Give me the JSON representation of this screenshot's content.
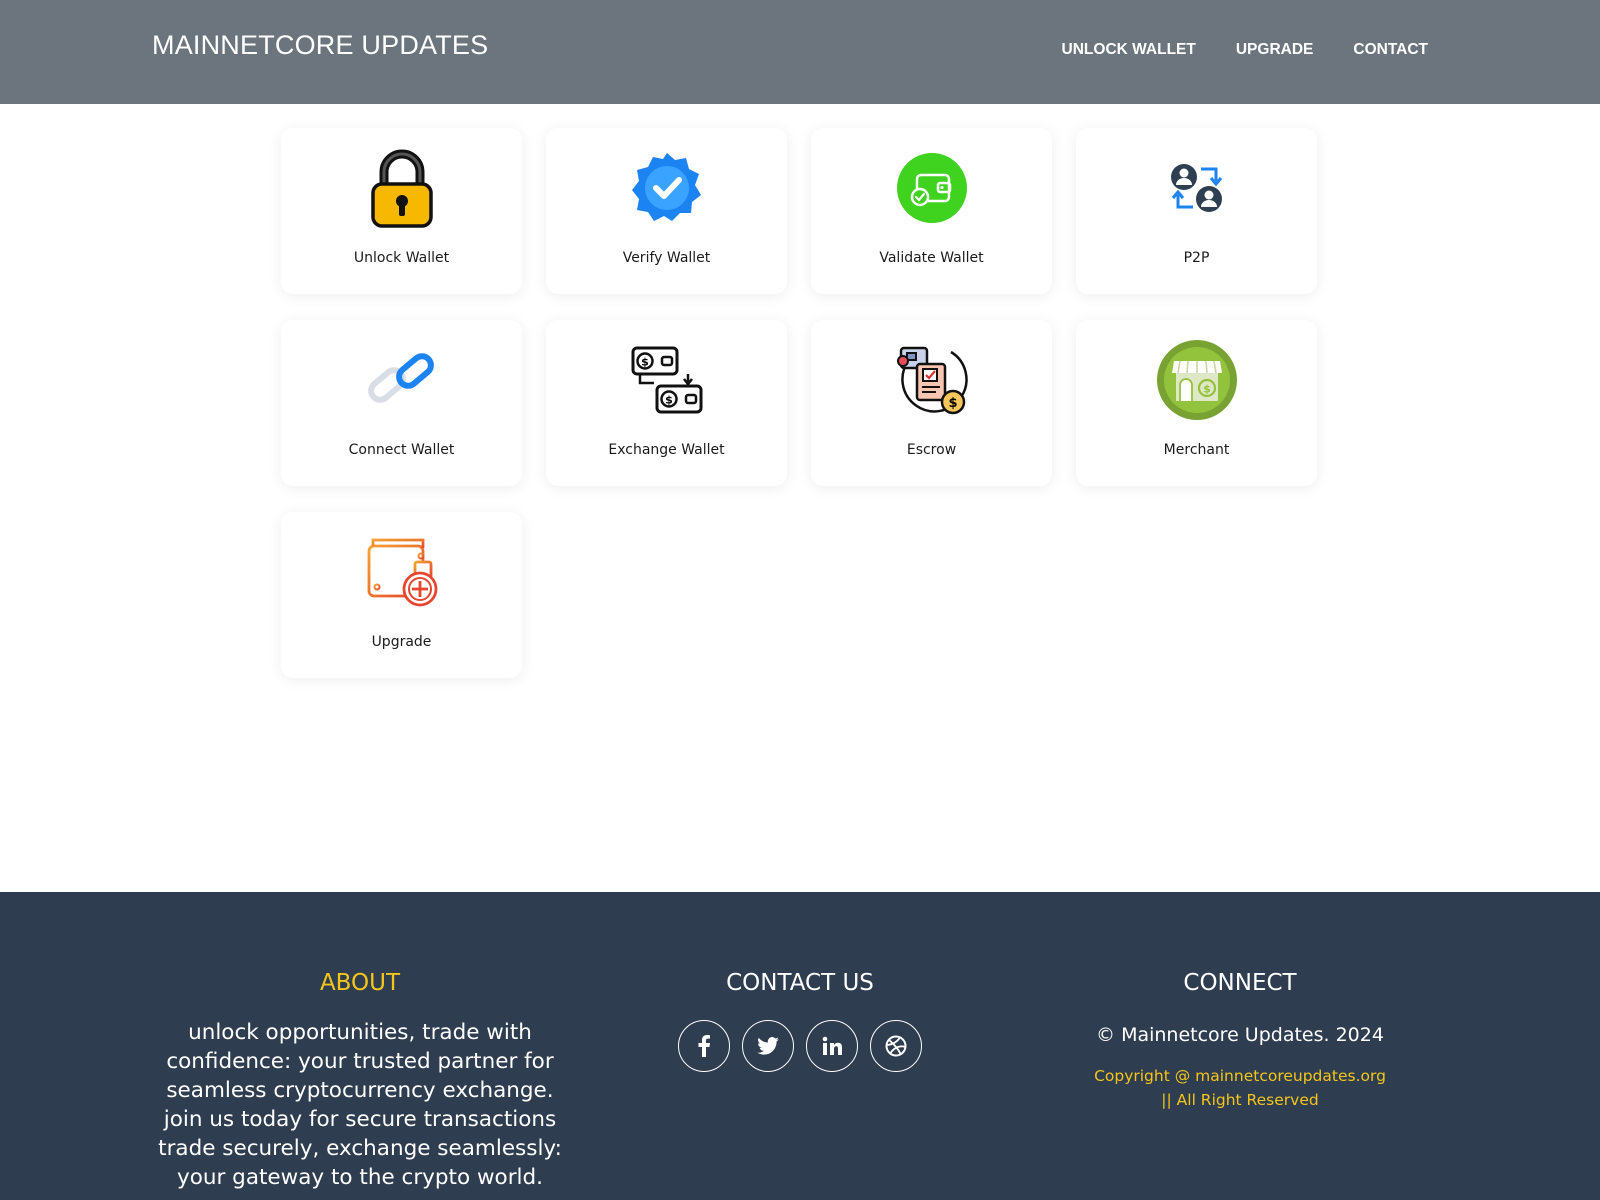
{
  "header": {
    "brand": "MAINNETCORE UPDATES",
    "nav": [
      "UNLOCK WALLET",
      "UPGRADE",
      "CONTACT"
    ]
  },
  "cards": [
    {
      "label": "Unlock Wallet",
      "icon": "padlock-icon"
    },
    {
      "label": "Verify Wallet",
      "icon": "verified-badge-icon"
    },
    {
      "label": "Validate Wallet",
      "icon": "wallet-check-icon"
    },
    {
      "label": "P2P",
      "icon": "p2p-transfer-icon"
    },
    {
      "label": "Connect Wallet",
      "icon": "chain-link-icon"
    },
    {
      "label": "Exchange Wallet",
      "icon": "money-exchange-icon"
    },
    {
      "label": "Escrow",
      "icon": "escrow-icon"
    },
    {
      "label": "Merchant",
      "icon": "storefront-icon"
    },
    {
      "label": "Upgrade",
      "icon": "wallet-add-icon"
    }
  ],
  "footer": {
    "about": {
      "title": "ABOUT",
      "text": "unlock opportunities, trade with confidence: your trusted partner for seamless cryptocurrency exchange. join us today for secure transactions trade securely, exchange seamlessly: your gateway to the crypto world."
    },
    "contact": {
      "title": "CONTACT US",
      "socials": [
        "facebook-icon",
        "twitter-icon",
        "linkedin-icon",
        "dribbble-icon"
      ]
    },
    "connect": {
      "title": "CONNECT",
      "copyright": "© Mainnetcore Updates. 2024",
      "rights": "Copyright @ mainnetcoreupdates.org || All Right Reserved"
    }
  },
  "colors": {
    "header_bg": "#6c757d",
    "footer_bg": "#2e3d50",
    "accent": "#f5c518"
  }
}
